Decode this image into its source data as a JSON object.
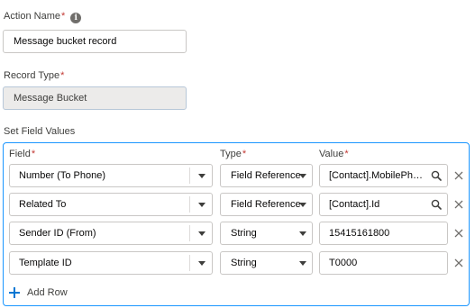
{
  "action_name": {
    "label": "Action Name",
    "required_mark": "*",
    "info_icon": "info-icon",
    "value": "Message bucket record"
  },
  "record_type": {
    "label": "Record Type",
    "required_mark": "*",
    "value": "Message Bucket"
  },
  "field_values": {
    "section_label": "Set Field Values",
    "columns": {
      "field": "Field",
      "type": "Type",
      "value": "Value",
      "required_mark": "*"
    },
    "rows": [
      {
        "field": "Number (To Phone)",
        "type": "Field Reference",
        "value": "[Contact].MobilePhone",
        "value_has_search": true
      },
      {
        "field": "Related To",
        "type": "Field Reference",
        "value": "[Contact].Id",
        "value_has_search": true
      },
      {
        "field": "Sender ID (From)",
        "type": "String",
        "value": "15415161800",
        "value_has_search": false
      },
      {
        "field": "Template ID",
        "type": "String",
        "value": "T0000",
        "value_has_search": false
      }
    ],
    "add_row_label": "Add Row"
  },
  "colors": {
    "accent": "#0176d3",
    "panel_border": "#1b96ff",
    "required": "#c23934"
  }
}
